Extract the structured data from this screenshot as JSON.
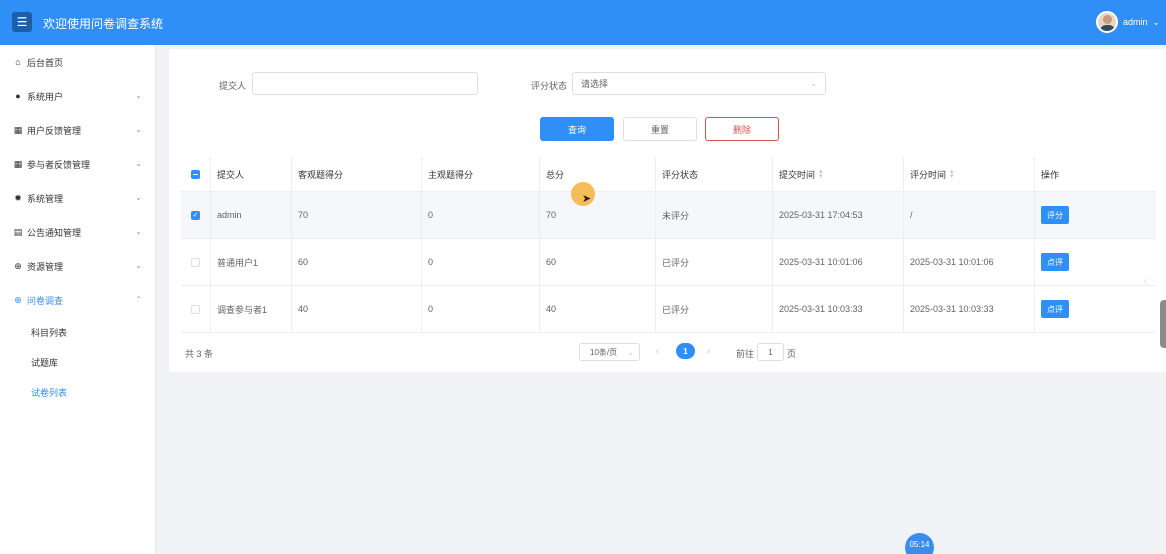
{
  "header": {
    "title": "欢迎使用问卷调查系统",
    "username": "admin",
    "menu_icon": "☰",
    "user_caret": "⌄"
  },
  "sidebar": {
    "items": [
      {
        "label": "后台首页",
        "icon": "home-icon",
        "glyph": "⌂",
        "expandable": false
      },
      {
        "label": "系统用户",
        "icon": "user-icon",
        "glyph": "●",
        "expandable": true
      },
      {
        "label": "用户反馈管理",
        "icon": "grid-icon",
        "glyph": "▦",
        "expandable": true
      },
      {
        "label": "参与者反馈管理",
        "icon": "grid-icon",
        "glyph": "▦",
        "expandable": true
      },
      {
        "label": "系统管理",
        "icon": "gear-icon",
        "glyph": "✹",
        "expandable": true
      },
      {
        "label": "公告通知管理",
        "icon": "doc-icon",
        "glyph": "▤",
        "expandable": true
      },
      {
        "label": "资源管理",
        "icon": "plus-circle-icon",
        "glyph": "⊕",
        "expandable": true
      },
      {
        "label": "问卷调查",
        "icon": "plus-circle-icon",
        "glyph": "⊕",
        "expandable": true,
        "open": true
      }
    ],
    "sub_items": [
      {
        "label": "科目列表",
        "active": false
      },
      {
        "label": "试题库",
        "active": false
      },
      {
        "label": "试卷列表",
        "active": true
      }
    ],
    "chevron_down": "⌄",
    "chevron_up": "⌃"
  },
  "filters": {
    "submitter_label": "提交人",
    "submitter_value": "",
    "status_label": "评分状态",
    "status_placeholder": "请选择",
    "select_arrow": "⌄"
  },
  "actions": {
    "search": "查询",
    "reset": "重置",
    "delete": "删除"
  },
  "table": {
    "columns": [
      "提交人",
      "客观题得分",
      "主观题得分",
      "总分",
      "评分状态",
      "提交时间",
      "评分时间",
      "操作"
    ],
    "rows": [
      {
        "submitter": "admin",
        "objective": "70",
        "subjective": "0",
        "total": "70",
        "status": "未评分",
        "submit_time": "2025-03-31 17:04:53",
        "score_time": "/",
        "op": "评分",
        "checked": true
      },
      {
        "submitter": "普通用户1",
        "objective": "60",
        "subjective": "0",
        "total": "60",
        "status": "已评分",
        "submit_time": "2025-03-31 10:01:06",
        "score_time": "2025-03-31 10:01:06",
        "op": "点评",
        "checked": false
      },
      {
        "submitter": "调查参与者1",
        "objective": "40",
        "subjective": "0",
        "total": "40",
        "status": "已评分",
        "submit_time": "2025-03-31 10:03:33",
        "score_time": "2025-03-31 10:03:33",
        "op": "点评",
        "checked": false
      }
    ],
    "check_mark": "✓",
    "sort_up": "▴",
    "sort_down": "▾"
  },
  "pagination": {
    "total_text": "共 3 条",
    "page_size": "10条/页",
    "prev": "‹",
    "current_page": "1",
    "next": "›",
    "goto_label": "前往",
    "goto_value": "1",
    "goto_suffix": "页"
  },
  "overlay": {
    "timer": "05:14",
    "cursor": "➤",
    "side_arrow": "‹"
  }
}
